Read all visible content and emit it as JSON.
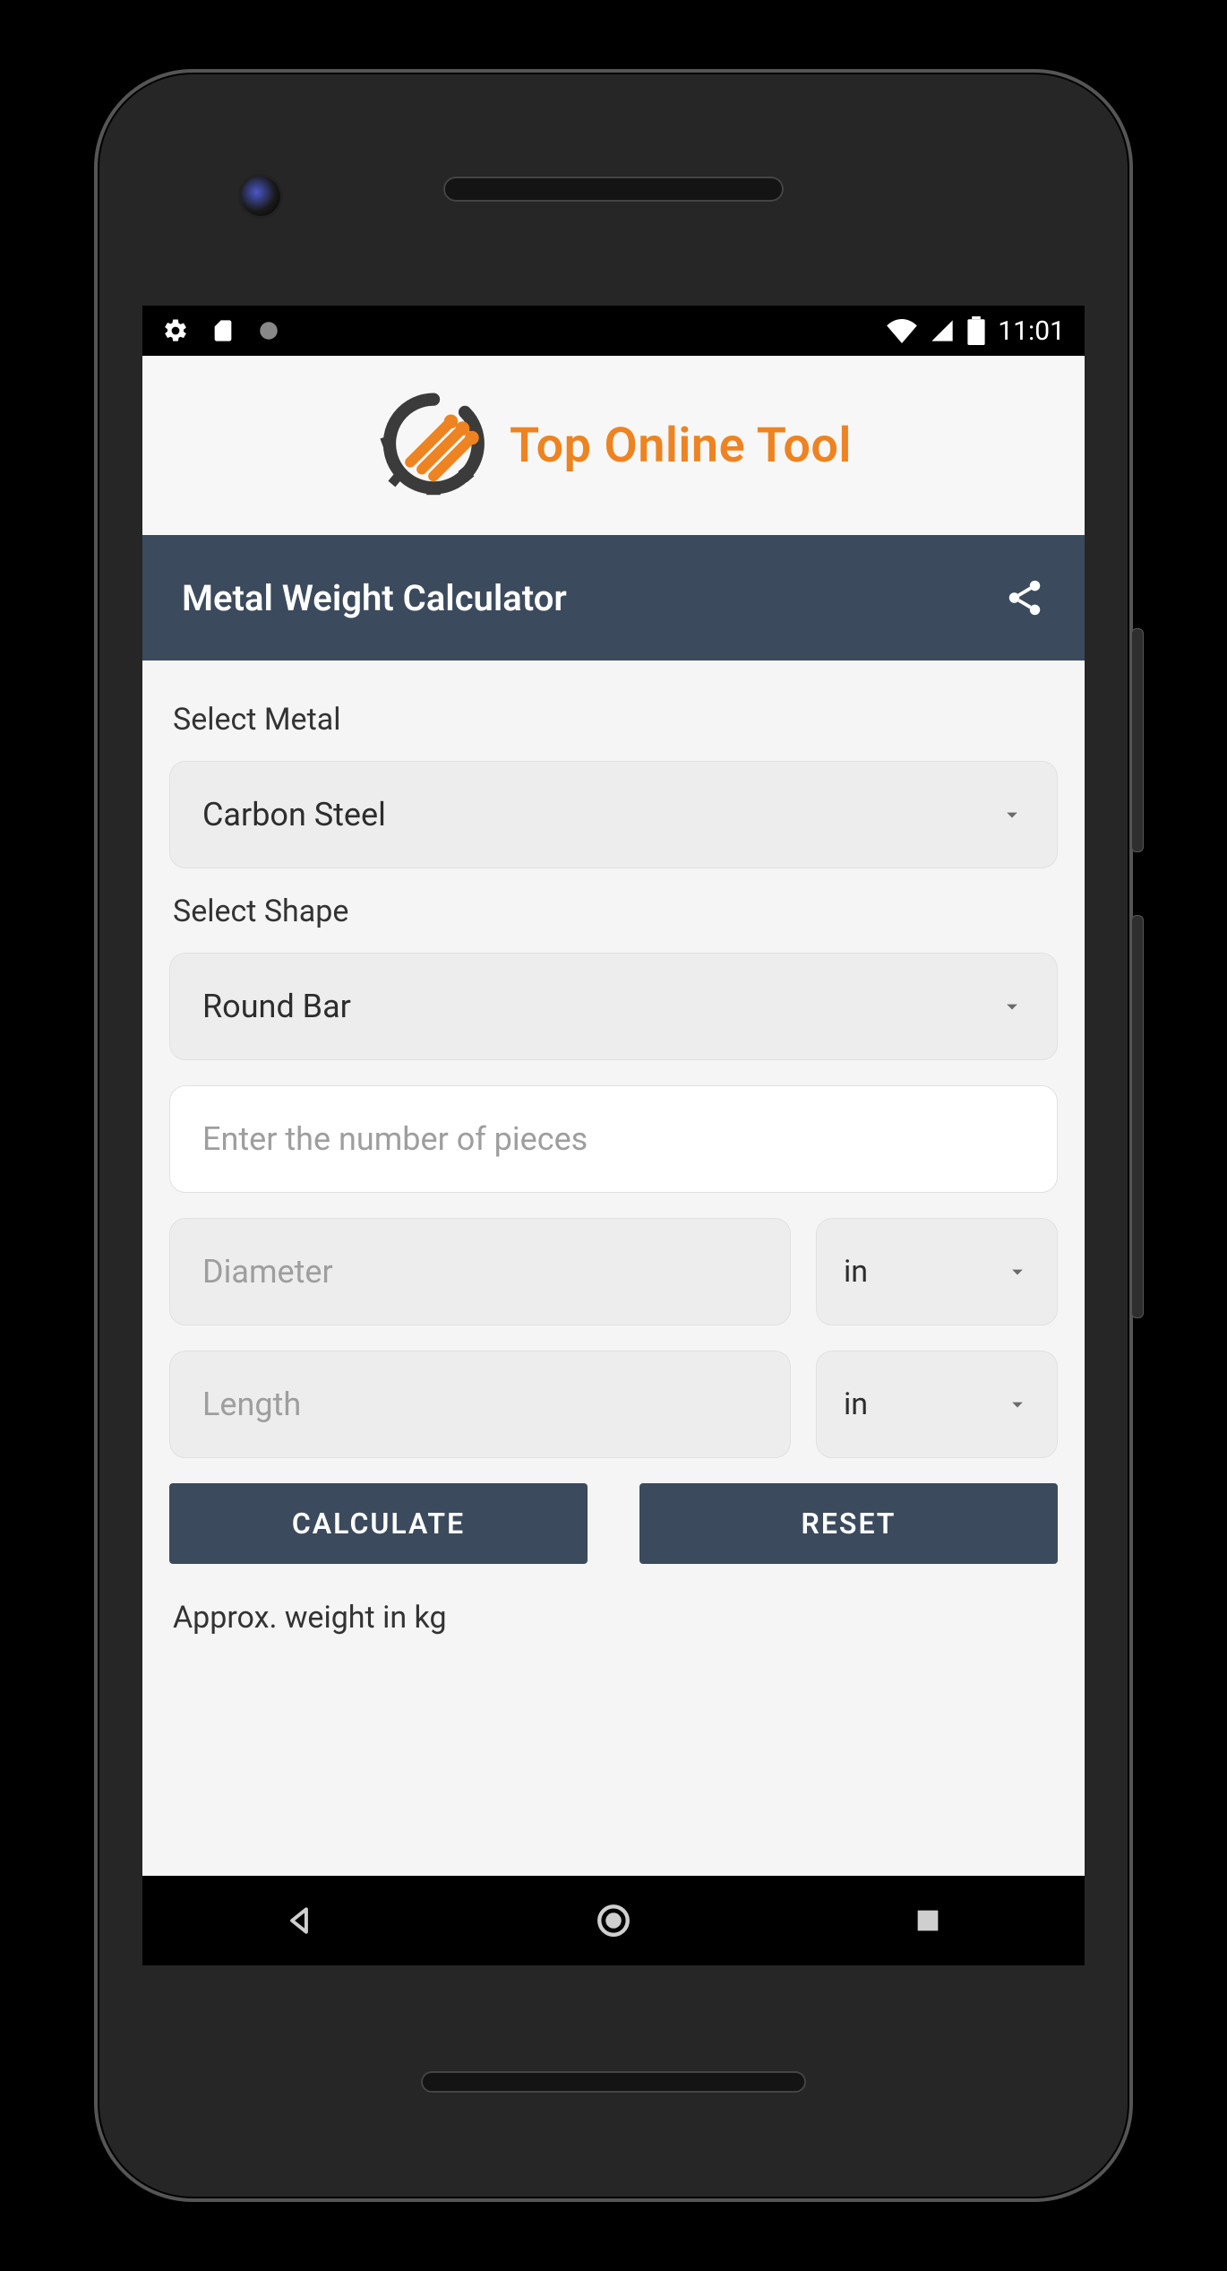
{
  "status": {
    "time": "11:01"
  },
  "brand": {
    "name": "Top Online Tool",
    "accent": "#ee8321"
  },
  "titlebar": {
    "title": "Metal Weight Calculator"
  },
  "form": {
    "metal": {
      "label": "Select Metal",
      "value": "Carbon Steel"
    },
    "shape": {
      "label": "Select Shape",
      "value": "Round Bar"
    },
    "pieces": {
      "placeholder": "Enter the number of pieces"
    },
    "diameter": {
      "placeholder": "Diameter",
      "unit": "in"
    },
    "length": {
      "placeholder": "Length",
      "unit": "in"
    },
    "calculate_label": "CALCULATE",
    "reset_label": "RESET",
    "result_label": "Approx. weight in kg"
  }
}
